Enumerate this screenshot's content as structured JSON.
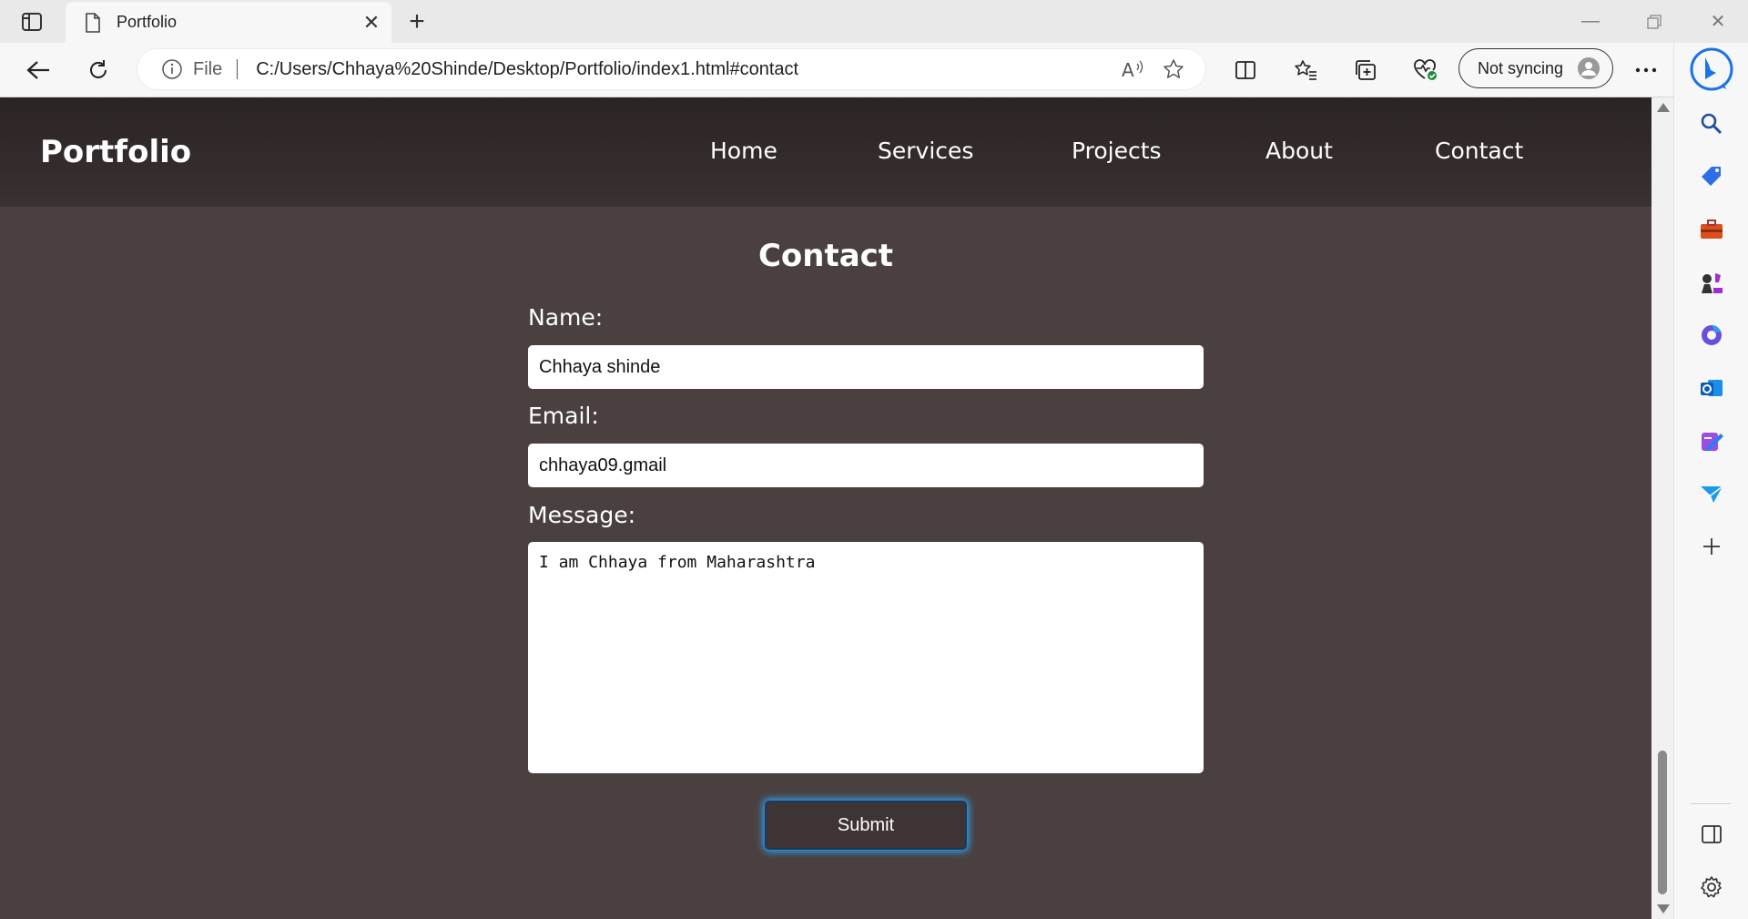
{
  "browser": {
    "tab_title": "Portfolio",
    "address": {
      "scheme_label": "File",
      "url": "C:/Users/Chhaya%20Shinde/Desktop/Portfolio/index1.html#contact"
    },
    "sync_label": "Not syncing",
    "icons": {
      "tab_actions": "tab-actions-icon",
      "favicon": "page-icon",
      "back": "back-arrow-icon",
      "refresh": "refresh-icon",
      "read_aloud": "read-aloud-icon",
      "favorite": "star-icon",
      "split_screen": "split-screen-icon",
      "favorites": "favorites-icon",
      "collections": "collections-icon",
      "browser_essentials": "heart-pulse-icon",
      "more": "more-icon",
      "copilot": "bing-copilot-icon"
    }
  },
  "sidebar": {
    "items": [
      "search-icon",
      "shopping-tag-icon",
      "tools-icon",
      "games-icon",
      "microsoft-365-icon",
      "outlook-icon",
      "designer-icon",
      "drop-icon",
      "add-icon"
    ],
    "bottom": [
      "sidebar-toggle-icon",
      "settings-icon"
    ]
  },
  "site": {
    "logo": "Portfolio",
    "nav": [
      {
        "label": "Home"
      },
      {
        "label": "Services"
      },
      {
        "label": "Projects"
      },
      {
        "label": "About"
      },
      {
        "label": "Contact"
      }
    ],
    "section_title": "Contact",
    "form": {
      "name_label": "Name:",
      "name_value": "Chhaya shinde",
      "email_label": "Email:",
      "email_value": "chhaya09.gmail",
      "message_label": "Message:",
      "message_value": "I am Chhaya from Maharashtra",
      "submit_label": "Submit"
    }
  },
  "colors": {
    "page_bg": "#4a4040",
    "header_bg": "#2b2424",
    "submit_glow": "#2ba9ff"
  }
}
